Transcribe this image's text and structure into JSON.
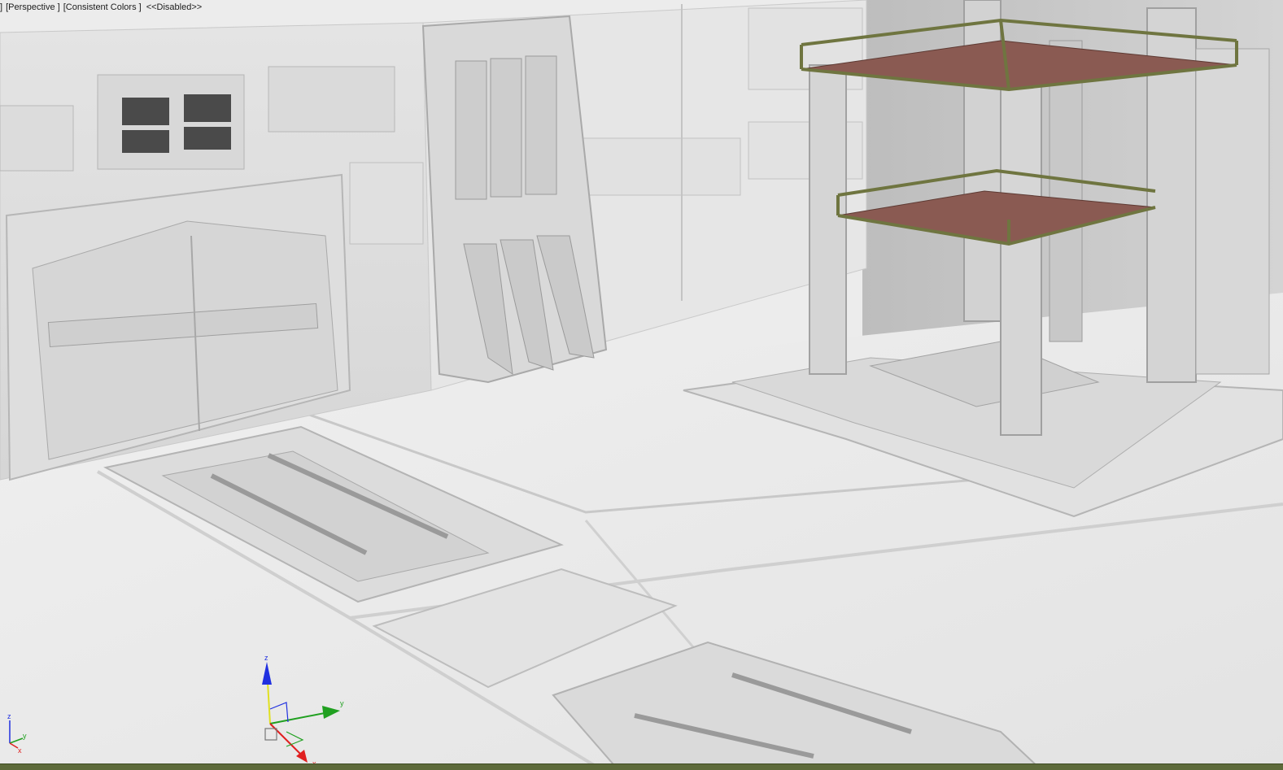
{
  "viewport": {
    "label_menu": "]",
    "label_view": "[Perspective ]",
    "label_shading": "[Consistent Colors ]",
    "label_state": "<<Disabled>>"
  },
  "gizmo": {
    "axis_x": "x",
    "axis_y": "y",
    "axis_z": "z"
  },
  "axis_tripod": {
    "axis_x": "x",
    "axis_y": "y",
    "axis_z": "z"
  },
  "colors": {
    "background": "#ececec",
    "railing": "#6f7540",
    "deck": "#8a5a52",
    "axis_x": "#e02020",
    "axis_y": "#20a020",
    "axis_z": "#2030e0",
    "bottom_bar": "#5d6a3a"
  }
}
